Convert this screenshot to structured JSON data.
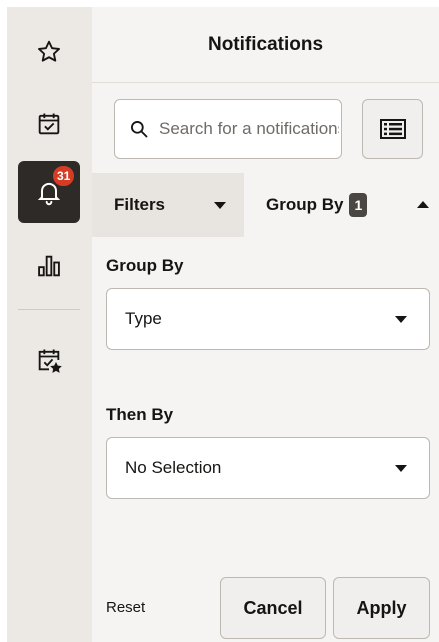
{
  "rail": {
    "items": [
      {
        "name": "favorites",
        "icon": "star-icon"
      },
      {
        "name": "tasks",
        "icon": "calendar-check-icon"
      },
      {
        "name": "notifications",
        "icon": "bell-icon",
        "badge": "31",
        "active": true
      },
      {
        "name": "analytics",
        "icon": "bar-chart-icon"
      },
      {
        "name": "starred-tasks",
        "icon": "calendar-check-star-icon"
      }
    ]
  },
  "panel": {
    "title": "Notifications",
    "search": {
      "placeholder": "Search for a notifications",
      "value": ""
    },
    "view_button_icon": "list-view-icon"
  },
  "tabs": {
    "filters_label": "Filters",
    "group_by_label": "Group By",
    "group_by_count": "1"
  },
  "group_by": {
    "label": "Group By",
    "value": "Type"
  },
  "then_by": {
    "label": "Then By",
    "value": "No Selection"
  },
  "actions": {
    "reset_label": "Reset",
    "cancel_label": "Cancel",
    "apply_label": "Apply"
  },
  "colors": {
    "badge": "#d63b25",
    "active_rail": "#2d2a27",
    "rail_bg": "#ece9e5",
    "panel_bg": "#f5f4f2"
  }
}
